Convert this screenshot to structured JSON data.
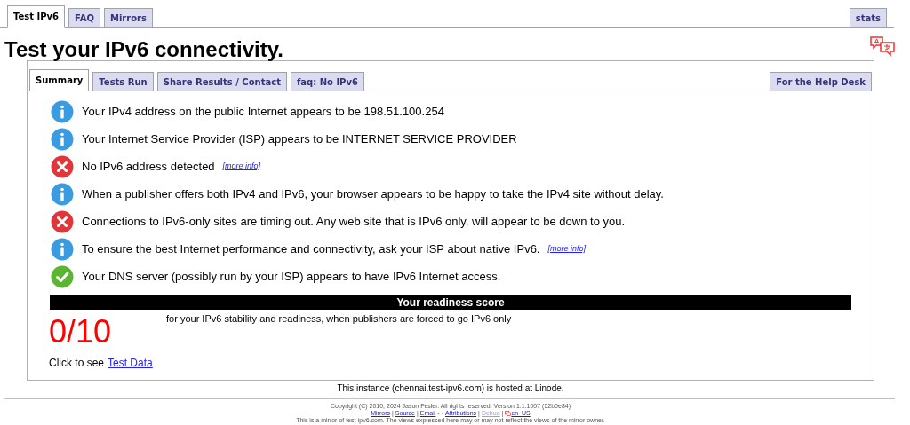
{
  "top_tabs": [
    {
      "label": "Test IPv6",
      "selected": true
    },
    {
      "label": "FAQ",
      "selected": false
    },
    {
      "label": "Mirrors",
      "selected": false
    }
  ],
  "stats_tab": {
    "label": "stats",
    "selected": false
  },
  "heading": "Test your IPv6 connectivity.",
  "panel_tabs": [
    {
      "label": "Summary",
      "selected": true
    },
    {
      "label": "Tests Run",
      "selected": false
    },
    {
      "label": "Share Results / Contact",
      "selected": false
    },
    {
      "label": "faq: No IPv6",
      "selected": false
    }
  ],
  "help_desk_tab": {
    "label": "For the Help Desk",
    "selected": false
  },
  "results": [
    {
      "kind": "info",
      "text": "Your IPv4 address on the public Internet appears to be 198.51.100.254"
    },
    {
      "kind": "info",
      "text": "Your Internet Service Provider (ISP) appears to be INTERNET SERVICE PROVIDER"
    },
    {
      "kind": "error",
      "text": "No IPv6 address detected",
      "link": "[more info]"
    },
    {
      "kind": "info",
      "text": "When a publisher offers both IPv4 and IPv6, your browser appears to be happy to take the IPv4 site without delay."
    },
    {
      "kind": "error",
      "text": "Connections to IPv6-only sites are timing out. Any web site that is IPv6 only, will appear to be down to you."
    },
    {
      "kind": "info",
      "text": "To ensure the best Internet performance and connectivity, ask your ISP about native IPv6.",
      "link": "[more info]"
    },
    {
      "kind": "ok",
      "text": "Your DNS server (possibly run by your ISP) appears to have IPv6 Internet access."
    }
  ],
  "score": {
    "title": "Your readiness score",
    "value": "0/10",
    "caption": "for your IPv6 stability and readiness, when publishers are forced to go IPv6 only"
  },
  "test_data": {
    "text": "Click to see",
    "link": "Test Data"
  },
  "instance_note": "This instance (chennai.test-ipv6.com) is hosted at Linode.",
  "footer": {
    "copyright": "Copyright (C) 2010, 2024 Jason Fesler. All rights reserved. Version 1.1.1007 (52b0e84)",
    "links": [
      {
        "kind": "link",
        "label": "Mirrors",
        "disabled": false
      },
      {
        "kind": "sep",
        "label": "|"
      },
      {
        "kind": "link",
        "label": "Source",
        "disabled": false
      },
      {
        "kind": "sep",
        "label": "|"
      },
      {
        "kind": "link",
        "label": "Email",
        "disabled": false
      },
      {
        "kind": "sep",
        "label": "-"
      },
      {
        "kind": "sep",
        "label": "-"
      },
      {
        "kind": "link",
        "label": "Attributions",
        "disabled": false
      },
      {
        "kind": "sep",
        "label": "|"
      },
      {
        "kind": "link",
        "label": "Debug",
        "disabled": true
      },
      {
        "kind": "sep",
        "label": "|"
      },
      {
        "kind": "locale",
        "label": "en_US",
        "disabled": false
      }
    ],
    "mirror_note": "This is a mirror of test-ipv6.com. The views expressed here may or may not reflect the views of the mirror owner."
  }
}
